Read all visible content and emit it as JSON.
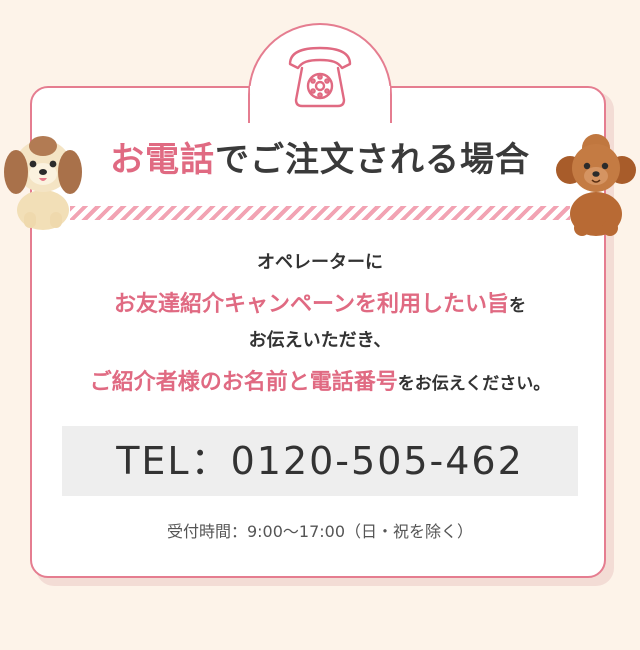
{
  "header": {
    "title_highlight": "お電話",
    "title_rest": "でご注文される場合"
  },
  "body": {
    "line1": "オペレーターに",
    "line2_highlight": "お友達紹介キャンペーンを利用したい旨",
    "line2_rest": "を",
    "line3": "お伝えいただき、",
    "line4_highlight": "ご紹介者様のお名前と電話番号",
    "line4_rest": "をお伝えください。"
  },
  "contact": {
    "tel": "TEL：0120-505-462",
    "hours": "受付時間：9:00～17:00（日・祝を除く）"
  },
  "icons": {
    "phone": "telephone-icon",
    "dog_left": "shih-tzu-dog-illustration",
    "dog_right": "toy-poodle-dog-illustration"
  },
  "colors": {
    "accent": "#e06a82",
    "border": "#e57d90",
    "background": "#fdf3e9"
  }
}
